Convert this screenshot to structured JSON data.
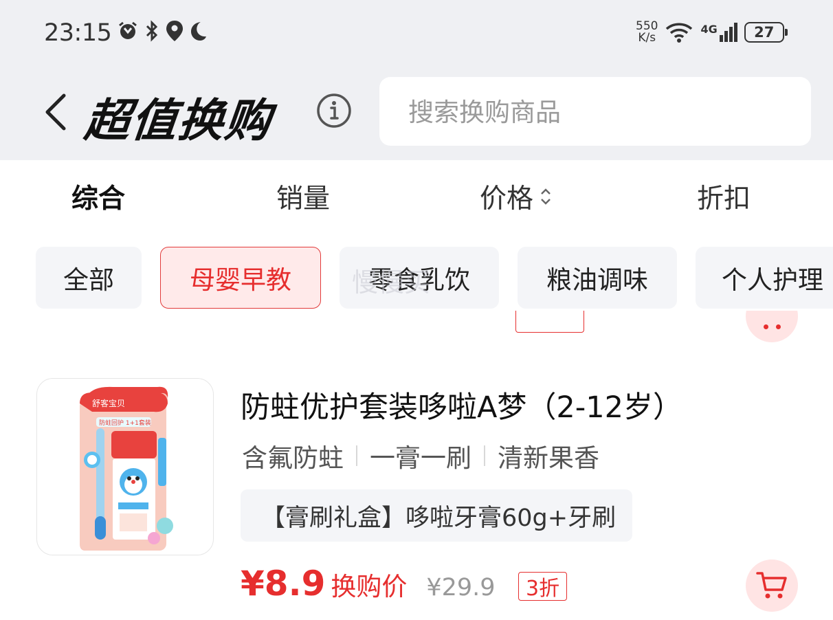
{
  "status_bar": {
    "time": "23:15",
    "speed_value": "550",
    "speed_unit": "K/s",
    "network": "4G",
    "battery": "27",
    "icons": [
      "alarm-icon",
      "bluetooth-icon",
      "location-icon",
      "moon-icon",
      "wifi-icon",
      "signal-icon",
      "battery-icon"
    ]
  },
  "header": {
    "title": "超值换购",
    "search_placeholder": "搜索换购商品"
  },
  "sort_tabs": [
    {
      "label": "综合",
      "active": true
    },
    {
      "label": "销量",
      "active": false
    },
    {
      "label": "价格",
      "active": false
    },
    {
      "label": "折扣",
      "active": false
    }
  ],
  "category_chips": [
    {
      "label": "全部",
      "active": false
    },
    {
      "label": "母婴早教",
      "active": true
    },
    {
      "label": "零食乳饮",
      "active": false
    },
    {
      "label": "粮油调味",
      "active": false
    },
    {
      "label": "个人护理",
      "active": false
    }
  ],
  "watermark": "慢慢买",
  "product": {
    "title": "防蛀优护套装哆啦A梦（2-12岁）",
    "tags": [
      "含氟防蛀",
      "一膏一刷",
      "清新果香"
    ],
    "spec": "【膏刷礼盒】哆啦牙膏60g+牙刷",
    "price": "¥8.9",
    "price_label": "换购价",
    "original_price": "¥29.9",
    "discount": "3折",
    "image_brand": "舒客宝贝",
    "image_badge": "防蛀回护 1+1套装"
  },
  "colors": {
    "accent": "#e62e2e",
    "chip_active_bg": "#ffeaea",
    "header_bg": "#eff0f3"
  }
}
